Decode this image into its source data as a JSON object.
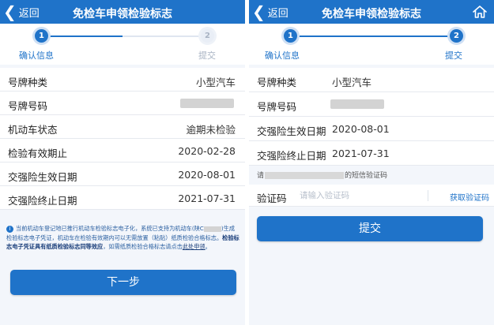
{
  "left": {
    "nav": {
      "back_label": "返回",
      "title": "免检车申领检验标志"
    },
    "steps": {
      "step1_num": "1",
      "step1_label": "确认信息",
      "step2_num": "2",
      "step2_label": "提交"
    },
    "rows": [
      {
        "label": "号牌种类",
        "value": "小型汽车"
      },
      {
        "label": "号牌号码",
        "value": ""
      },
      {
        "label": "机动车状态",
        "value": "逾期未检验"
      },
      {
        "label": "检验有效期止",
        "value": "2020-02-28"
      },
      {
        "label": "交强险生效日期",
        "value": "2020-08-01"
      },
      {
        "label": "交强险终止日期",
        "value": "2021-07-31"
      }
    ],
    "notice": {
      "icon": "i",
      "part1": "当前机动车登记地已推行机动车检验标志电子化，系统已支持为机动车(陕C",
      "part2": ")生成检验标志电子凭证，机动车在检验有效期内可以无需放置（粘贴）纸质检验合格标志。",
      "emph": "检验标志电子凭证具有纸质检验标志同等效应",
      "part3": "，如需纸质检验合格标志请点击",
      "link": "此处申领",
      "end": "。"
    },
    "next_button": "下一步"
  },
  "right": {
    "nav": {
      "back_label": "返回",
      "title": "免检车申领检验标志"
    },
    "steps": {
      "step1_num": "1",
      "step1_label": "确认信息",
      "step2_num": "2",
      "step2_label": "提交"
    },
    "rows": [
      {
        "label": "号牌种类",
        "value": "小型汽车"
      },
      {
        "label": "号牌号码",
        "value": ""
      },
      {
        "label": "交强险生效日期",
        "value": "2020-08-01"
      },
      {
        "label": "交强险终止日期",
        "value": "2021-07-31"
      }
    ],
    "sms_tip_start": "请",
    "sms_tip_end": "的短信验证码",
    "code": {
      "label": "验证码",
      "placeholder": "请输入验证码",
      "get_label": "获取验证码"
    },
    "submit_button": "提交"
  },
  "colors": {
    "brand_blue": "#1f73c9",
    "background": "#f3f6fb",
    "inactive": "#a8b3c3"
  },
  "icons": {
    "back": "chevron-left-icon",
    "home": "home-icon",
    "info": "info-icon"
  }
}
